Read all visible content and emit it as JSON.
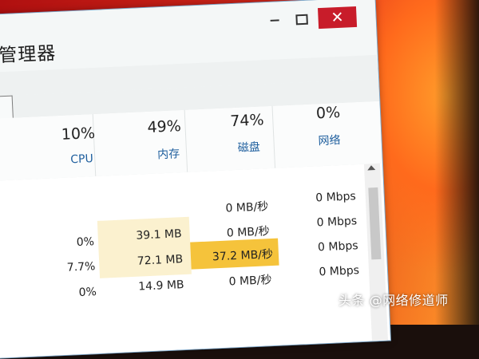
{
  "window": {
    "title": "管理器",
    "close_glyph": "✕"
  },
  "columns": {
    "cpu": {
      "percent": "10%",
      "label": "CPU"
    },
    "memory": {
      "percent": "49%",
      "label": "内存"
    },
    "disk": {
      "percent": "74%",
      "label": "磁盘"
    },
    "network": {
      "percent": "0%",
      "label": "网络"
    }
  },
  "rows": [
    {
      "cpu": "",
      "memory": "",
      "disk": "0 MB/秒",
      "network": "0 Mbps"
    },
    {
      "cpu": "0%",
      "memory": "39.1 MB",
      "disk": "0 MB/秒",
      "network": "0 Mbps"
    },
    {
      "cpu": "7.7%",
      "memory": "72.1 MB",
      "disk": "37.2 MB/秒",
      "network": "0 Mbps"
    },
    {
      "cpu": "0%",
      "memory": "14.9 MB",
      "disk": "0 MB/秒",
      "network": "0 Mbps"
    }
  ],
  "watermark": "头条 @网络修道师",
  "colors": {
    "accent_label": "#1f5f9e",
    "close_button": "#c81c2a",
    "disk_highlight": "#f5c33b",
    "memory_shade": "#fbf1cf"
  }
}
